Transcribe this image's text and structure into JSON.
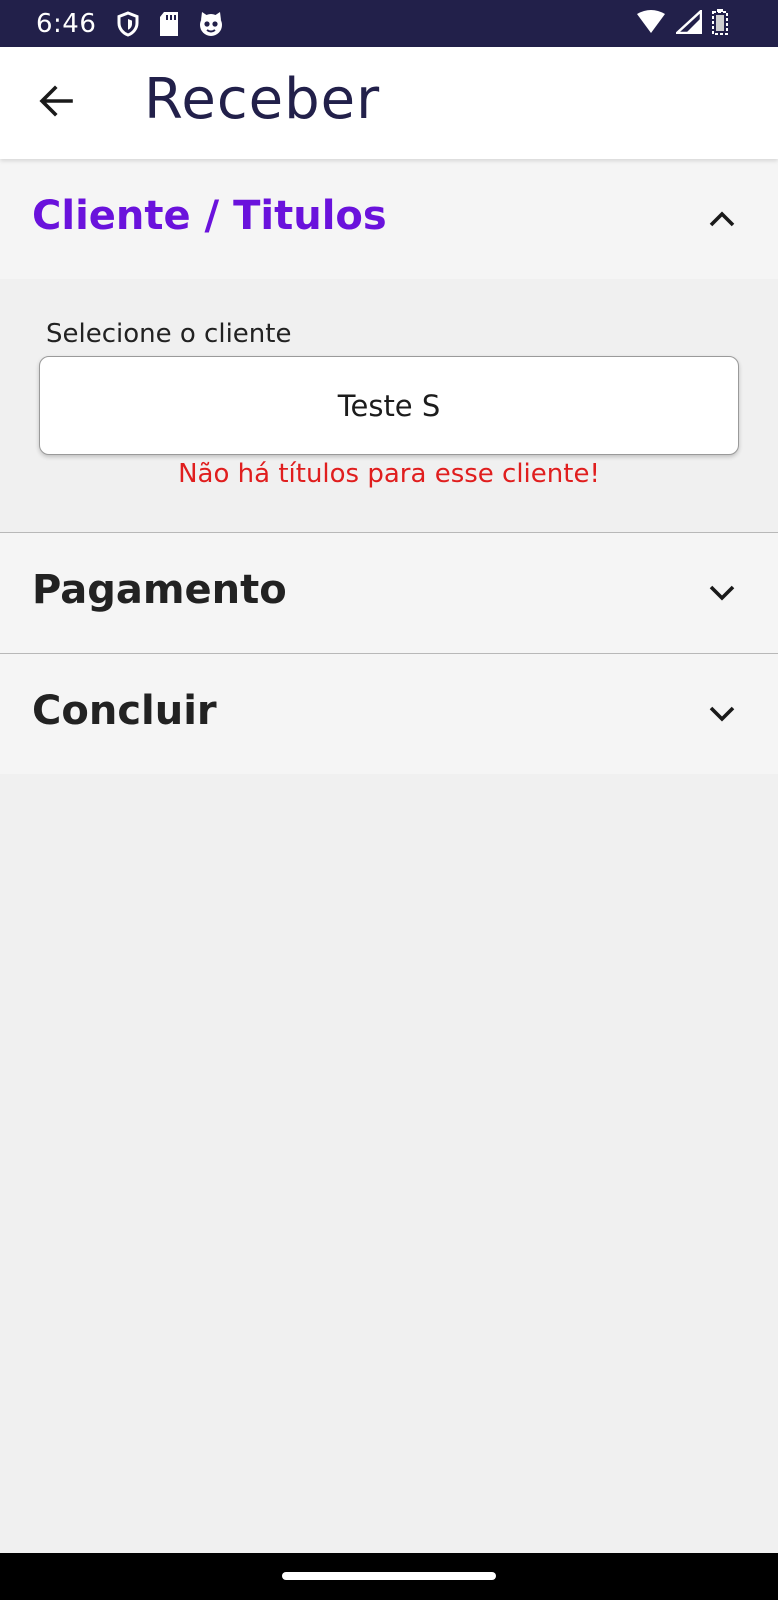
{
  "status_bar": {
    "time": "6:46",
    "icons_left": [
      "shield-icon",
      "sd-card-icon",
      "cat-face-icon"
    ],
    "icons_right": [
      "wifi-icon",
      "signal-icon",
      "battery-icon"
    ]
  },
  "app_bar": {
    "back_icon": "arrow-left-icon",
    "title": "Receber"
  },
  "sections": {
    "cliente": {
      "title": "Cliente / Titulos",
      "expanded": true,
      "color": "#6a12dc",
      "field_label": "Selecione o cliente",
      "field_value": "Teste S",
      "error_message": "Não há títulos para esse cliente!",
      "error_color": "#e01e1e"
    },
    "pagamento": {
      "title": "Pagamento",
      "expanded": false,
      "color": "#222222"
    },
    "concluir": {
      "title": "Concluir",
      "expanded": false,
      "color": "#222222"
    }
  }
}
